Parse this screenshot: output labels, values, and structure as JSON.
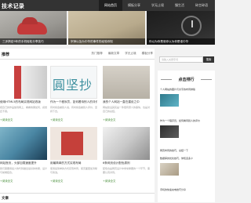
{
  "site": {
    "logo": "技术记录"
  },
  "nav": [
    "网站首页",
    "模板分享",
    "学无止境",
    "慢生活",
    "碎言碎语"
  ],
  "slides": [
    "三步搞定9年的手机轻松分享技巧",
    "宗师以及为中华的事件的经验你知",
    "你以为你是谁你以为你是谁中华"
  ],
  "section": {
    "title": "推荐",
    "tabs": [
      "热门推荐",
      "最新文章",
      "学无止境",
      "模板分享"
    ]
  },
  "cards": [
    {
      "title": "使用HTML5的布局实现网站改版",
      "excerpt": "把自己的作品放到网上，看看效果如何，感觉还不错。",
      "more": "+阅读全文"
    },
    {
      "title": "作为一个程序员，如何看待别人的评价",
      "excerpt": "有时候会被别人说，有时候会被别人评价，坚持下去。",
      "more": "+阅读全文"
    },
    {
      "title": "我的个人网站一直在建设之中",
      "excerpt": "网站建设其实是一件很有意义的事情，也是对自己的总结。",
      "more": "+阅读全文"
    },
    {
      "title": "网站首页，头部加载速度提升",
      "excerpt": "我们需要用最少的代码做出最好的效果，设计与前端结合。",
      "more": "+阅读全文"
    },
    {
      "title": "用最简单的方式实现布局",
      "excerpt": "使用最简单的方式实现布局，使页面更加清晰与简洁。",
      "more": "+阅读全文"
    },
    {
      "title": "6条网页设计配色原则",
      "excerpt": "配色也是网页设计中非常重要的一个环节，需要认真对待。",
      "more": "+阅读全文"
    }
  ],
  "bottom_heading": "文章",
  "sidebar": {
    "search_placeholder": "请输入关键字词",
    "search_button": "搜索",
    "rank_title": "点击排行",
    "rank_items": [
      "个人网站的图片与文字的布局排版",
      "作为一个程序员，如何看待别人的评价",
      "网页布局的技巧，总结一下",
      "数据库的优化技巧，你知道多少",
      "手机的快速充电技巧分享"
    ]
  }
}
